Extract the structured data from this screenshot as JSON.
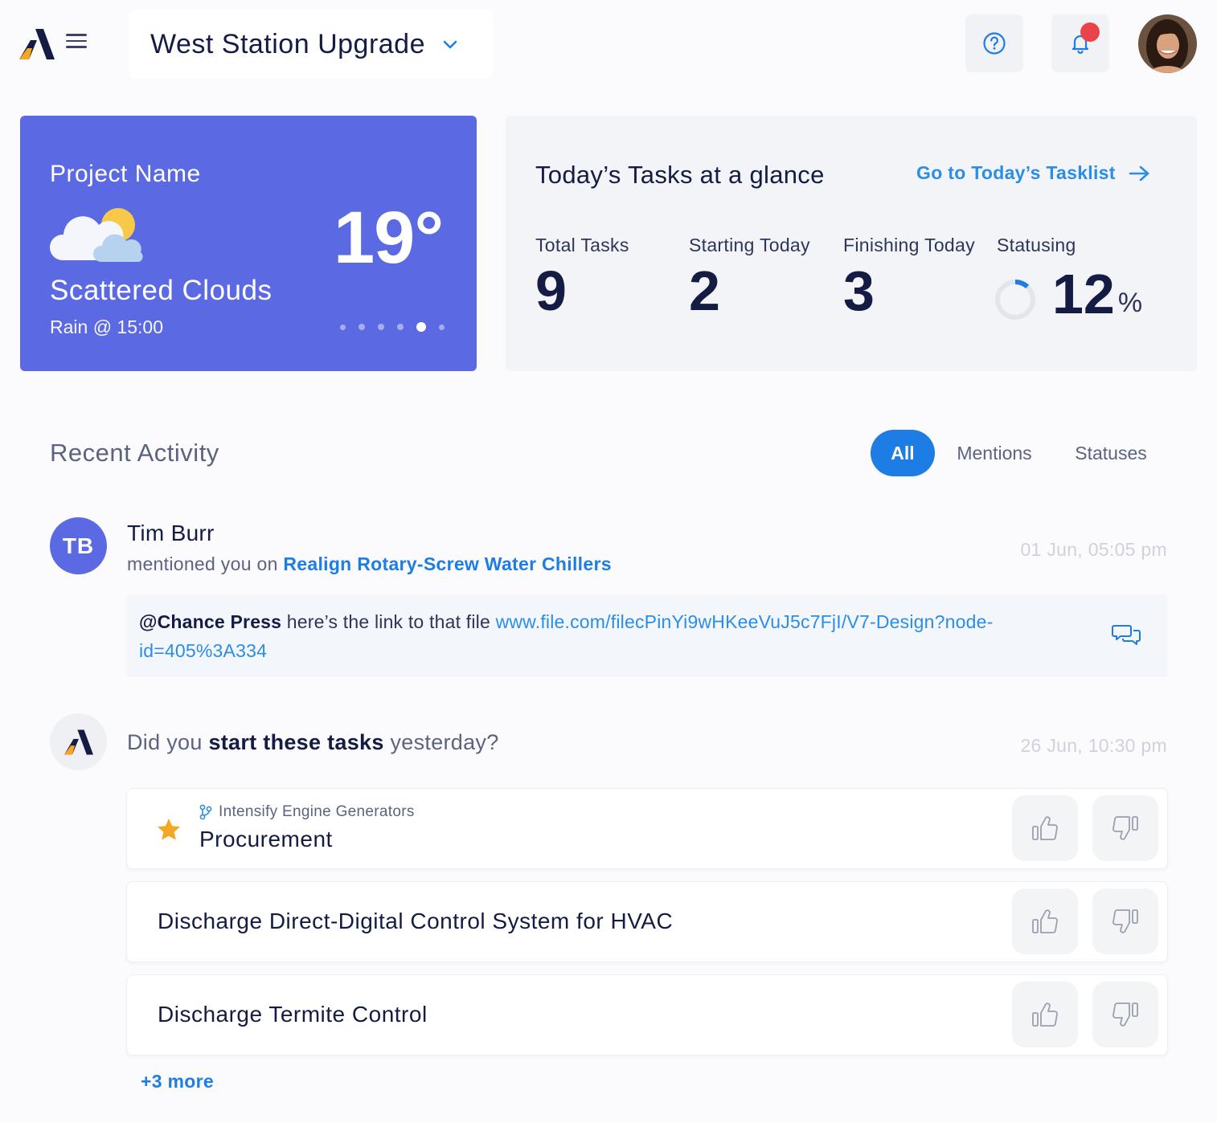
{
  "header": {
    "project_title": "West Station Upgrade",
    "has_notification": true
  },
  "weather": {
    "project_name": "Project Name",
    "temperature": "19°",
    "condition": "Scattered Clouds",
    "forecast": "Rain @ 15:00",
    "carousel_pages": 6,
    "carousel_active_index": 4,
    "icon": "partly-cloudy-icon"
  },
  "tasks_glance": {
    "title": "Today’s Tasks at a glance",
    "link_label": "Go to Today’s Tasklist",
    "stats": [
      {
        "label": "Total Tasks",
        "value": "9"
      },
      {
        "label": "Starting Today",
        "value": "2"
      },
      {
        "label": "Finishing Today",
        "value": "3"
      }
    ],
    "statusing": {
      "label": "Statusing",
      "value": "12",
      "unit": "%",
      "fraction": 0.12
    }
  },
  "recent_activity": {
    "title": "Recent Activity",
    "tabs": [
      {
        "label": "All",
        "active": true
      },
      {
        "label": "Mentions",
        "active": false
      },
      {
        "label": "Statuses",
        "active": false
      }
    ],
    "mention": {
      "avatar_initials": "TB",
      "name": "Tim Burr",
      "action": "mentioned you on",
      "task": "Realign Rotary-Screw Water Chillers",
      "time": "01 Jun, 05:05 pm",
      "comment": {
        "mention": "@Chance Press",
        "text": " here’s the link to that file ",
        "url": "www.file.com/filecPinYi9wHKeeVuJ5c7FjI/V7-Design?node-id=405%3A334"
      }
    },
    "prompt": {
      "q_before": "Did you ",
      "q_bold": "start these tasks",
      "q_after": " yesterday?",
      "time": "26 Jun, 10:30 pm",
      "tasks": [
        {
          "parent": "Intensify Engine Generators",
          "name": "Procurement",
          "starred": true
        },
        {
          "name": "Discharge Direct-Digital Control System for HVAC"
        },
        {
          "name": "Discharge Termite Control"
        }
      ],
      "more_label": "+3 more"
    }
  },
  "colors": {
    "accent_blue": "#1d7de4",
    "weather_card": "#5b6ae2",
    "notification_red": "#e8454a",
    "logo_dark": "#141c44",
    "logo_yellow": "#f5a623"
  }
}
